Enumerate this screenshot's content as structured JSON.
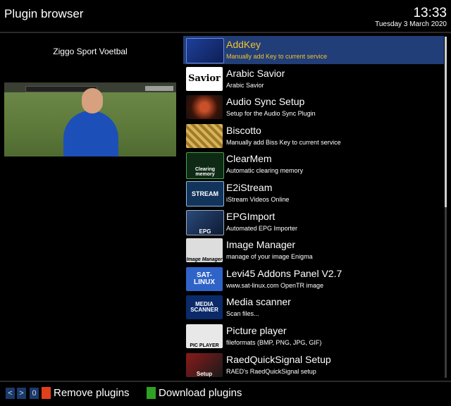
{
  "header": {
    "title": "Plugin browser",
    "time": "13:33",
    "date": "Tuesday  3 March 2020"
  },
  "preview": {
    "channel": "Ziggo Sport Voetbal"
  },
  "plugins": [
    {
      "name": "AddKey",
      "desc": "Manually add Key to current service",
      "icon": "addkey-icon",
      "thumb_text": "",
      "selected": true
    },
    {
      "name": "Arabic Savior",
      "desc": "Arabic Savior",
      "icon": "arabic-savior-icon",
      "thumb_text": "Savior"
    },
    {
      "name": "Audio Sync Setup",
      "desc": "Setup for the Audio Sync Plugin",
      "icon": "audio-sync-icon",
      "thumb_text": ""
    },
    {
      "name": "Biscotto",
      "desc": "Manually add Biss Key to current service",
      "icon": "biscotto-icon",
      "thumb_text": ""
    },
    {
      "name": "ClearMem",
      "desc": "Automatic clearing memory",
      "icon": "clearmem-icon",
      "thumb_text": "Clearing memory"
    },
    {
      "name": "E2iStream",
      "desc": "iStream Videos Online",
      "icon": "e2istream-icon",
      "thumb_text": "STREAM"
    },
    {
      "name": "EPGImport",
      "desc": "Automated EPG Importer",
      "icon": "epgimport-icon",
      "thumb_text": "EPG"
    },
    {
      "name": "Image Manager",
      "desc": "manage of your image Enigma",
      "icon": "image-manager-icon",
      "thumb_text": "Image Manager"
    },
    {
      "name": "Levi45 Addons Panel V2.7",
      "desc": "www.sat-linux.com OpenTR image",
      "icon": "sat-linux-icon",
      "thumb_text": "SAT-LINUX"
    },
    {
      "name": "Media scanner",
      "desc": "Scan files...",
      "icon": "media-scanner-icon",
      "thumb_text": "MEDIA SCANNER"
    },
    {
      "name": "Picture player",
      "desc": "fileformats (BMP, PNG, JPG, GIF)",
      "icon": "picture-player-icon",
      "thumb_text": "PIC PLAYER"
    },
    {
      "name": "RaedQuickSignal Setup",
      "desc": "RAED's RaedQuickSignal setup",
      "icon": "raedquicksignal-icon",
      "thumb_text": "Setup"
    }
  ],
  "footer": {
    "nav_prev": "<",
    "nav_next": ">",
    "counter": "0",
    "red_label": "Remove plugins",
    "green_label": "Download plugins",
    "colors": {
      "red": "#e0401c",
      "green": "#2ea023",
      "selected_text": "#f2c230",
      "selected_bg": "#223e78"
    }
  },
  "scroll": {
    "position_fraction": 0.0,
    "visible_fraction": 0.5
  }
}
